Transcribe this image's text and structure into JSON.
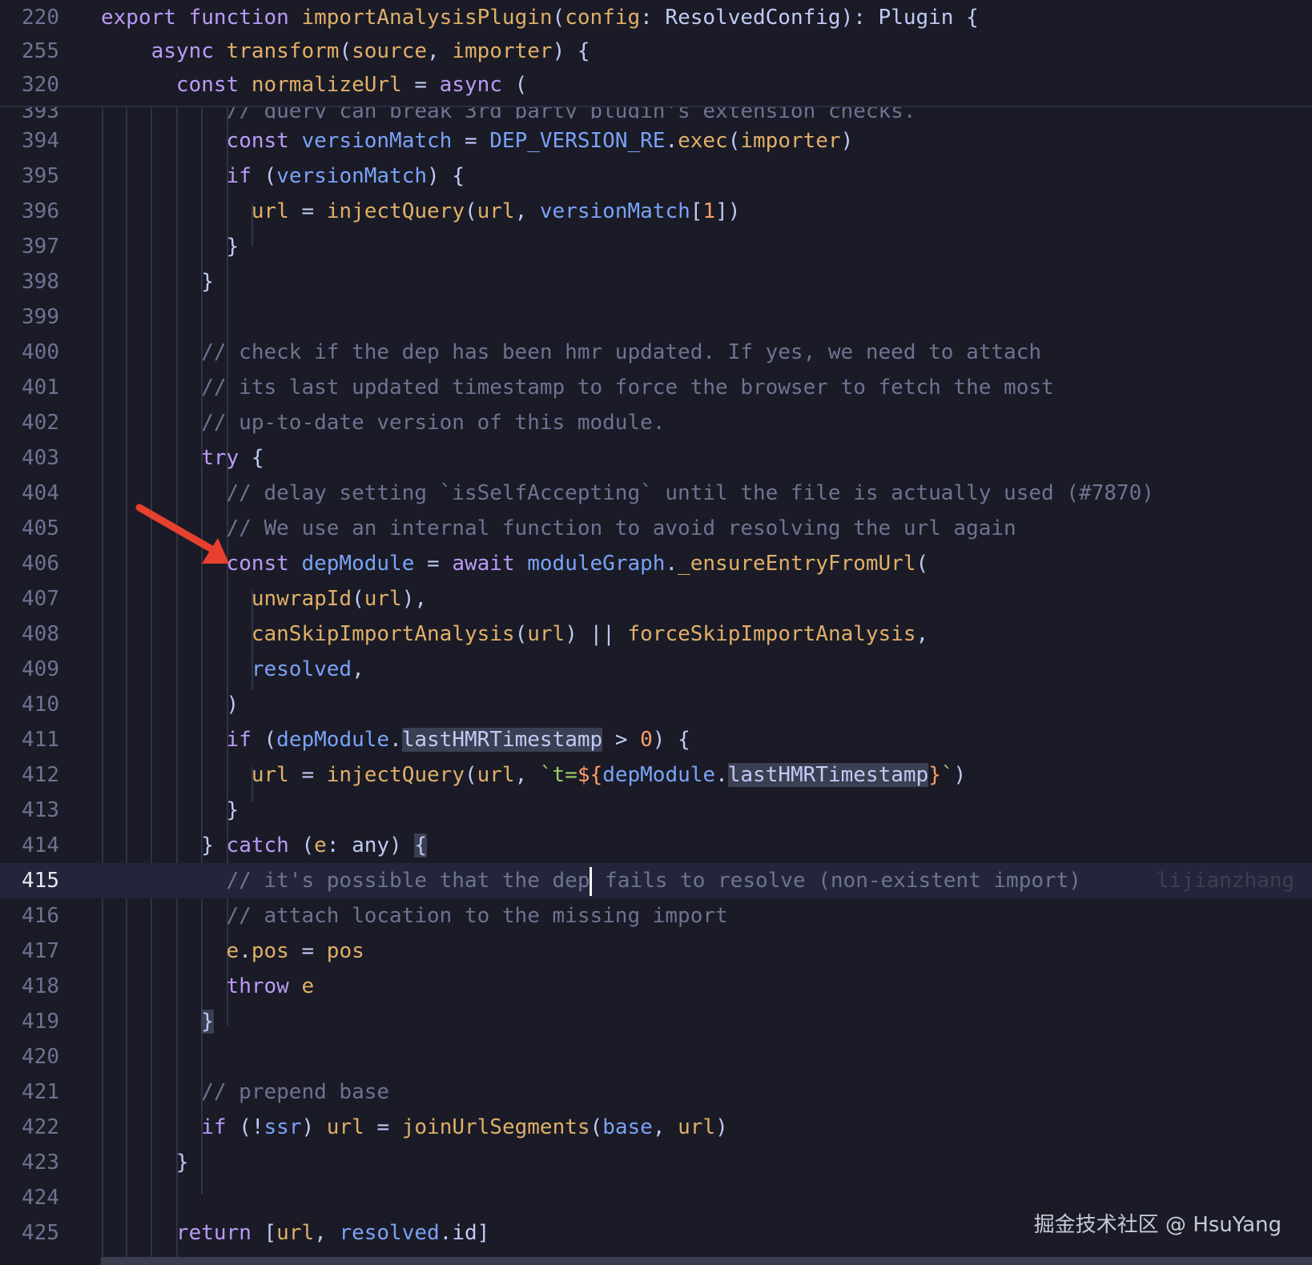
{
  "editor": {
    "sticky_lines": [
      {
        "num": "220",
        "tokens": [
          [
            "kw",
            "export "
          ],
          [
            "kw",
            "function "
          ],
          [
            "fn",
            "importAnalysisPlugin"
          ],
          [
            "pun",
            "("
          ],
          [
            "fn",
            "config"
          ],
          [
            "pun",
            ": ResolvedConfig): Plugin {"
          ]
        ]
      },
      {
        "num": "255",
        "tokens": [
          [
            "pun",
            "    "
          ],
          [
            "kw",
            "async "
          ],
          [
            "fn",
            "transform"
          ],
          [
            "pun",
            "("
          ],
          [
            "fn",
            "source"
          ],
          [
            "pun",
            ", "
          ],
          [
            "fn",
            "importer"
          ],
          [
            "pun",
            ") {"
          ]
        ]
      },
      {
        "num": "320",
        "tokens": [
          [
            "pun",
            "      "
          ],
          [
            "kw",
            "const "
          ],
          [
            "fn",
            "normalizeUrl"
          ],
          [
            "pun",
            " = "
          ],
          [
            "kw",
            "async "
          ],
          [
            "pun",
            "("
          ]
        ]
      }
    ],
    "partial_line": {
      "num": "393",
      "tokens": [
        [
          "cm",
          "          // query can break 3rd party plugin's extension checks."
        ]
      ]
    },
    "lines": [
      {
        "num": "394",
        "tokens": [
          [
            "pun",
            "          "
          ],
          [
            "kw",
            "const "
          ],
          [
            "var",
            "versionMatch"
          ],
          [
            "pun",
            " = "
          ],
          [
            "var",
            "DEP_VERSION_RE"
          ],
          [
            "pun",
            "."
          ],
          [
            "fn",
            "exec"
          ],
          [
            "pun",
            "("
          ],
          [
            "fn",
            "importer"
          ],
          [
            "pun",
            ")"
          ]
        ]
      },
      {
        "num": "395",
        "tokens": [
          [
            "pun",
            "          "
          ],
          [
            "kw",
            "if "
          ],
          [
            "pun",
            "("
          ],
          [
            "var",
            "versionMatch"
          ],
          [
            "pun",
            ") {"
          ]
        ]
      },
      {
        "num": "396",
        "tokens": [
          [
            "pun",
            "            "
          ],
          [
            "fn",
            "url"
          ],
          [
            "pun",
            " = "
          ],
          [
            "fn",
            "injectQuery"
          ],
          [
            "pun",
            "("
          ],
          [
            "fn",
            "url"
          ],
          [
            "pun",
            ", "
          ],
          [
            "var",
            "versionMatch"
          ],
          [
            "pun",
            "["
          ],
          [
            "num",
            "1"
          ],
          [
            "pun",
            "])"
          ]
        ]
      },
      {
        "num": "397",
        "tokens": [
          [
            "pun",
            "          }"
          ]
        ]
      },
      {
        "num": "398",
        "tokens": [
          [
            "pun",
            "        }"
          ]
        ]
      },
      {
        "num": "399",
        "tokens": []
      },
      {
        "num": "400",
        "tokens": [
          [
            "cm",
            "        // check if the dep has been hmr updated. If yes, we need to attach"
          ]
        ]
      },
      {
        "num": "401",
        "tokens": [
          [
            "cm",
            "        // its last updated timestamp to force the browser to fetch the most"
          ]
        ]
      },
      {
        "num": "402",
        "tokens": [
          [
            "cm",
            "        // up-to-date version of this module."
          ]
        ]
      },
      {
        "num": "403",
        "tokens": [
          [
            "pun",
            "        "
          ],
          [
            "kw",
            "try "
          ],
          [
            "pun",
            "{"
          ]
        ]
      },
      {
        "num": "404",
        "tokens": [
          [
            "cm",
            "          // delay setting `isSelfAccepting` until the file is actually used (#7870)"
          ]
        ]
      },
      {
        "num": "405",
        "tokens": [
          [
            "cm",
            "          // We use an internal function to avoid resolving the url again"
          ]
        ]
      },
      {
        "num": "406",
        "tokens": [
          [
            "pun",
            "          "
          ],
          [
            "kw",
            "const "
          ],
          [
            "var",
            "depModule"
          ],
          [
            "pun",
            " = "
          ],
          [
            "kw",
            "await "
          ],
          [
            "var",
            "moduleGraph"
          ],
          [
            "pun",
            "."
          ],
          [
            "fn",
            "_ensureEntryFromUrl"
          ],
          [
            "pun",
            "("
          ]
        ]
      },
      {
        "num": "407",
        "tokens": [
          [
            "pun",
            "            "
          ],
          [
            "fn",
            "unwrapId"
          ],
          [
            "pun",
            "("
          ],
          [
            "fn",
            "url"
          ],
          [
            "pun",
            "),"
          ]
        ]
      },
      {
        "num": "408",
        "tokens": [
          [
            "pun",
            "            "
          ],
          [
            "fn",
            "canSkipImportAnalysis"
          ],
          [
            "pun",
            "("
          ],
          [
            "fn",
            "url"
          ],
          [
            "pun",
            ") || "
          ],
          [
            "fn",
            "forceSkipImportAnalysis"
          ],
          [
            "pun",
            ","
          ]
        ]
      },
      {
        "num": "409",
        "tokens": [
          [
            "pun",
            "            "
          ],
          [
            "var",
            "resolved"
          ],
          [
            "pun",
            ","
          ]
        ]
      },
      {
        "num": "410",
        "tokens": [
          [
            "pun",
            "          )"
          ]
        ]
      },
      {
        "num": "411",
        "tokens": [
          [
            "pun",
            "          "
          ],
          [
            "kw",
            "if "
          ],
          [
            "pun",
            "("
          ],
          [
            "var",
            "depModule"
          ],
          [
            "pun",
            "."
          ],
          [
            "hl",
            "lastHMRTimestamp"
          ],
          [
            "pun",
            " > "
          ],
          [
            "num",
            "0"
          ],
          [
            "pun",
            ") {"
          ]
        ]
      },
      {
        "num": "412",
        "tokens": [
          [
            "pun",
            "            "
          ],
          [
            "fn",
            "url"
          ],
          [
            "pun",
            " = "
          ],
          [
            "fn",
            "injectQuery"
          ],
          [
            "pun",
            "("
          ],
          [
            "fn",
            "url"
          ],
          [
            "pun",
            ", "
          ],
          [
            "str",
            "`t="
          ],
          [
            "num",
            "${"
          ],
          [
            "var",
            "depModule"
          ],
          [
            "pun",
            "."
          ],
          [
            "hl",
            "lastHMRTimestamp"
          ],
          [
            "num",
            "}"
          ],
          [
            "str",
            "`"
          ],
          [
            "pun",
            ")"
          ]
        ]
      },
      {
        "num": "413",
        "tokens": [
          [
            "pun",
            "          }"
          ]
        ]
      },
      {
        "num": "414",
        "tokens": [
          [
            "pun",
            "        } "
          ],
          [
            "kw",
            "catch "
          ],
          [
            "pun",
            "("
          ],
          [
            "fn",
            "e"
          ],
          [
            "pun",
            ": any) "
          ],
          [
            "hl",
            "{"
          ]
        ]
      },
      {
        "num": "415",
        "current": true,
        "tokens": [
          [
            "cm",
            "          // it's possible that the dep"
          ],
          [
            "cursor",
            ""
          ],
          [
            "cm",
            " fails to resolve (non-existent import)"
          ],
          [
            "blame",
            "      lijianzhang"
          ]
        ]
      },
      {
        "num": "416",
        "tokens": [
          [
            "cm",
            "          // attach location to the missing import"
          ]
        ]
      },
      {
        "num": "417",
        "tokens": [
          [
            "pun",
            "          "
          ],
          [
            "fn",
            "e"
          ],
          [
            "pun",
            "."
          ],
          [
            "fn",
            "pos"
          ],
          [
            "pun",
            " = "
          ],
          [
            "fn",
            "pos"
          ]
        ]
      },
      {
        "num": "418",
        "tokens": [
          [
            "pun",
            "          "
          ],
          [
            "kw",
            "throw "
          ],
          [
            "fn",
            "e"
          ]
        ]
      },
      {
        "num": "419",
        "tokens": [
          [
            "pun",
            "        "
          ],
          [
            "hl",
            "}"
          ]
        ]
      },
      {
        "num": "420",
        "tokens": []
      },
      {
        "num": "421",
        "tokens": [
          [
            "cm",
            "        // prepend base"
          ]
        ]
      },
      {
        "num": "422",
        "tokens": [
          [
            "pun",
            "        "
          ],
          [
            "kw",
            "if "
          ],
          [
            "pun",
            "(!"
          ],
          [
            "var",
            "ssr"
          ],
          [
            "pun",
            ") "
          ],
          [
            "fn",
            "url"
          ],
          [
            "pun",
            " = "
          ],
          [
            "fn",
            "joinUrlSegments"
          ],
          [
            "pun",
            "("
          ],
          [
            "var",
            "base"
          ],
          [
            "pun",
            ", "
          ],
          [
            "fn",
            "url"
          ],
          [
            "pun",
            ")"
          ]
        ]
      },
      {
        "num": "423",
        "tokens": [
          [
            "pun",
            "      }"
          ]
        ]
      },
      {
        "num": "424",
        "tokens": []
      },
      {
        "num": "425",
        "tokens": [
          [
            "pun",
            "      "
          ],
          [
            "kw",
            "return "
          ],
          [
            "pun",
            "["
          ],
          [
            "fn",
            "url"
          ],
          [
            "pun",
            ", "
          ],
          [
            "var",
            "resolved"
          ],
          [
            "pun",
            ".id]"
          ]
        ]
      }
    ]
  },
  "watermark": "掘金技术社区 @ HsuYang",
  "colors": {
    "background": "#1a1b26",
    "keyword": "#bb9af7",
    "function": "#e0af68",
    "variable": "#7aa2f7",
    "comment": "#6e7392",
    "string": "#9ece6a",
    "number": "#ff9e64",
    "arrow": "#e8402e"
  }
}
